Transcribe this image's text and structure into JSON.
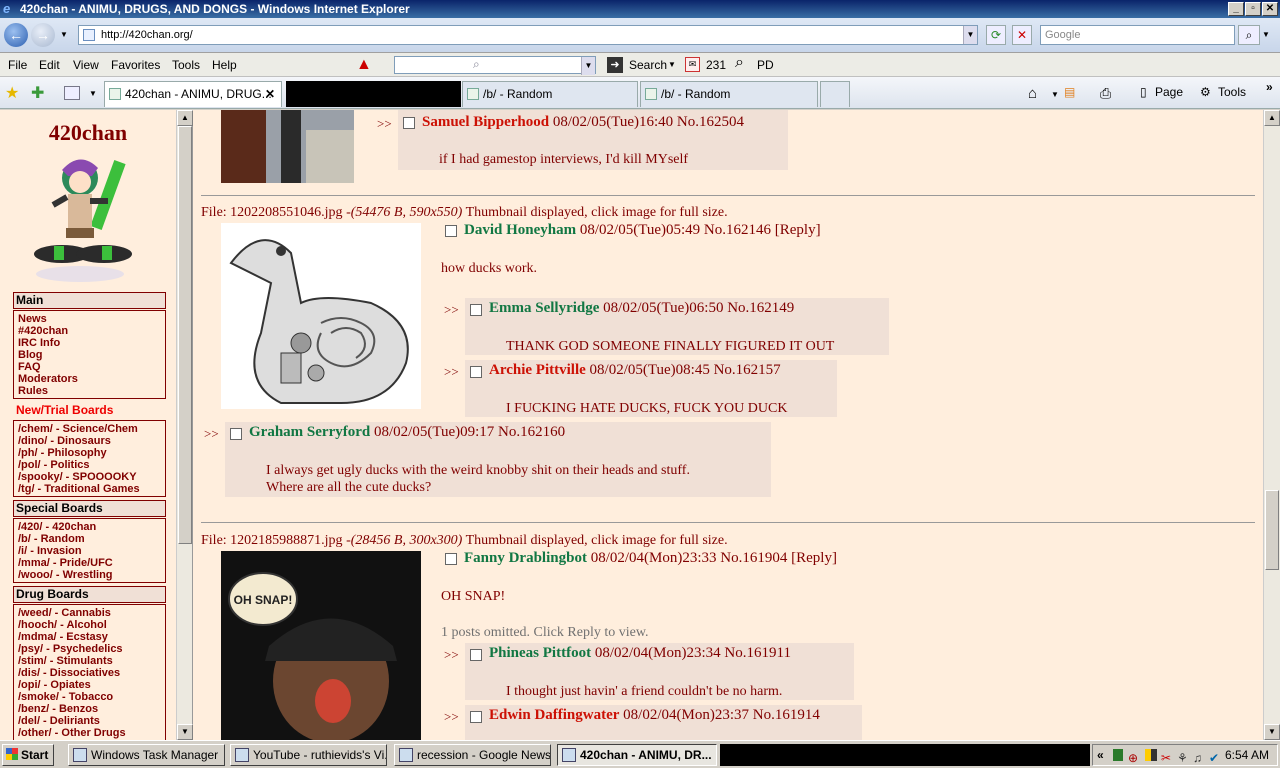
{
  "window": {
    "title": "420chan - ANIMU, DRUGS, AND DONGS - Windows Internet Explorer"
  },
  "address": {
    "url": "http://420chan.org/",
    "search_placeholder": "Google"
  },
  "menu": {
    "items": [
      "File",
      "Edit",
      "View",
      "Favorites",
      "Tools",
      "Help"
    ],
    "search_label": "Search",
    "count": "231",
    "pd": "PD"
  },
  "tabs": [
    {
      "label": "420chan - ANIMU, DRUG..."
    },
    {
      "label": "/b/ - Random"
    },
    {
      "label": "/b/ - Random"
    }
  ],
  "toolbar_right": {
    "page": "Page",
    "tools": "Tools"
  },
  "sidebar": {
    "logo": "420chan",
    "sections": [
      {
        "title": "Main",
        "items": [
          "News",
          "#420chan",
          "IRC Info",
          "Blog",
          "FAQ",
          "Moderators",
          "Rules"
        ]
      },
      {
        "title": "New/Trial Boards",
        "items": [
          "/chem/ - Science/Chem",
          "/dino/ - Dinosaurs",
          "/ph/ - Philosophy",
          "/pol/ - Politics",
          "/spooky/ - SPOOOOKY",
          "/tg/ - Traditional Games"
        ]
      },
      {
        "title": "Special Boards",
        "items": [
          "/420/ - 420chan",
          "/b/ - Random",
          "/i/ - Invasion",
          "/mma/ - Pride/UFC",
          "/wooo/ - Wrestling"
        ]
      },
      {
        "title": "Drug Boards",
        "items": [
          "/weed/ - Cannabis",
          "/hooch/ - Alcohol",
          "/mdma/ - Ecstasy",
          "/psy/ - Psychedelics",
          "/stim/ - Stimulants",
          "/dis/ - Dissociatives",
          "/opi/ - Opiates",
          "/smoke/ - Tobacco",
          "/benz/ - Benzos",
          "/del/ - Deliriants",
          "/other/ - Other Drugs"
        ]
      }
    ]
  },
  "posts": {
    "p0": {
      "arrows": ">>",
      "name": "Samuel Bipperhood",
      "date": "08/02/05(Tue)16:40",
      "no": "No.162504",
      "msg": "if I had gamestop interviews, I'd kill MYself"
    },
    "thread1": {
      "file_prefix": "File:",
      "file_name": "1202208551046.jpg",
      "file_meta": "-(54476 B, 590x550)",
      "file_suffix": "Thumbnail displayed, click image for full size.",
      "op": {
        "name": "David Honeyham",
        "date": "08/02/05(Tue)05:49",
        "no": "No.162146",
        "reply": "[Reply]",
        "msg": "how ducks work."
      },
      "replies": [
        {
          "arrows": ">>",
          "name": "Emma Sellyridge",
          "date": "08/02/05(Tue)06:50",
          "no": "No.162149",
          "msg": "THANK GOD SOMEONE FINALLY FIGURED IT OUT"
        },
        {
          "arrows": ">>",
          "name": "Archie Pittville",
          "date": "08/02/05(Tue)08:45",
          "no": "No.162157",
          "msg": "I FUCKING HATE DUCKS, FUCK YOU DUCK"
        },
        {
          "arrows": ">>",
          "name": "Graham Serryford",
          "date": "08/02/05(Tue)09:17",
          "no": "No.162160",
          "msg1": "I always get ugly ducks with the weird knobby shit on their heads and stuff.",
          "msg2": "Where are all the cute ducks?"
        }
      ]
    },
    "thread2": {
      "file_prefix": "File:",
      "file_name": "1202185988871.jpg",
      "file_meta": "-(28456 B, 300x300)",
      "file_suffix": "Thumbnail displayed, click image for full size.",
      "op": {
        "name": "Fanny Drablingbot",
        "date": "08/02/04(Mon)23:33",
        "no": "No.161904",
        "reply": "[Reply]",
        "msg": "OH SNAP!"
      },
      "omitted": "1 posts omitted. Click Reply to view.",
      "image_text": "OH SNAP!",
      "replies": [
        {
          "arrows": ">>",
          "name": "Phineas Pittfoot",
          "date": "08/02/04(Mon)23:34",
          "no": "No.161911",
          "msg": "I thought just havin' a friend couldn't be no harm."
        },
        {
          "arrows": ">>",
          "name": "Edwin Daffingwater",
          "date": "08/02/04(Mon)23:37",
          "no": "No.161914"
        }
      ]
    }
  },
  "taskbar": {
    "start": "Start",
    "tasks": [
      "Windows Task Manager",
      "YouTube - ruthievids's Vi...",
      "recession - Google News ...",
      "420chan - ANIMU, DR..."
    ],
    "clock": "6:54 AM",
    "tray_chevron": "«"
  },
  "colors": {
    "board_bg": "#ffeedd",
    "reply_bg": "#f0e0d6",
    "name_green": "#117743",
    "accent": "#800000"
  }
}
